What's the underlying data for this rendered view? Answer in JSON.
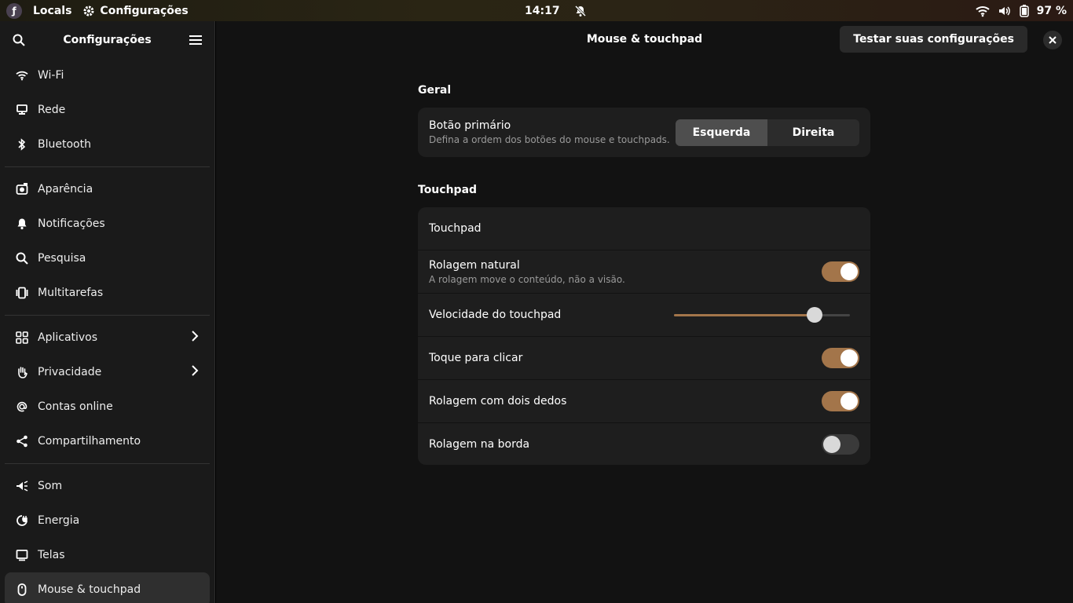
{
  "topbar": {
    "locals": "Locals",
    "app": "Configurações",
    "time": "14:17",
    "battery": "97 %"
  },
  "sidebar": {
    "title": "Configurações",
    "groups": [
      [
        {
          "label": "Wi-Fi",
          "icon": "wifi-icon"
        },
        {
          "label": "Rede",
          "icon": "network-icon"
        },
        {
          "label": "Bluetooth",
          "icon": "bluetooth-icon"
        }
      ],
      [
        {
          "label": "Aparência",
          "icon": "appearance-icon"
        },
        {
          "label": "Notificações",
          "icon": "bell-icon"
        },
        {
          "label": "Pesquisa",
          "icon": "search-icon"
        },
        {
          "label": "Multitarefas",
          "icon": "multitask-icon"
        }
      ],
      [
        {
          "label": "Aplicativos",
          "icon": "apps-icon",
          "chevron": true
        },
        {
          "label": "Privacidade",
          "icon": "hand-icon",
          "chevron": true
        },
        {
          "label": "Contas online",
          "icon": "at-icon"
        },
        {
          "label": "Compartilhamento",
          "icon": "share-icon"
        }
      ],
      [
        {
          "label": "Som",
          "icon": "speaker-icon"
        },
        {
          "label": "Energia",
          "icon": "power-icon"
        },
        {
          "label": "Telas",
          "icon": "display-icon"
        },
        {
          "label": "Mouse & touchpad",
          "icon": "mouse-icon",
          "active": true
        }
      ]
    ]
  },
  "main": {
    "title": "Mouse & touchpad",
    "test_button": "Testar suas configurações",
    "general": {
      "heading": "Geral",
      "primary_label": "Botão primário",
      "primary_sub": "Defina a ordem dos botões do mouse e touchpads.",
      "left": "Esquerda",
      "right": "Direita"
    },
    "touchpad": {
      "heading": "Touchpad",
      "rows": {
        "touchpad": "Touchpad",
        "natural_label": "Rolagem natural",
        "natural_sub": "A rolagem move o conteúdo, não a visão.",
        "speed_label": "Velocidade do touchpad",
        "tap_label": "Toque para clicar",
        "two_finger_label": "Rolagem com dois dedos",
        "edge_label": "Rolagem na borda"
      },
      "speed_value": 0.83,
      "natural_on": true,
      "tap_on": true,
      "two_finger_on": true,
      "edge_on": false
    },
    "accent": "#a3754a"
  }
}
